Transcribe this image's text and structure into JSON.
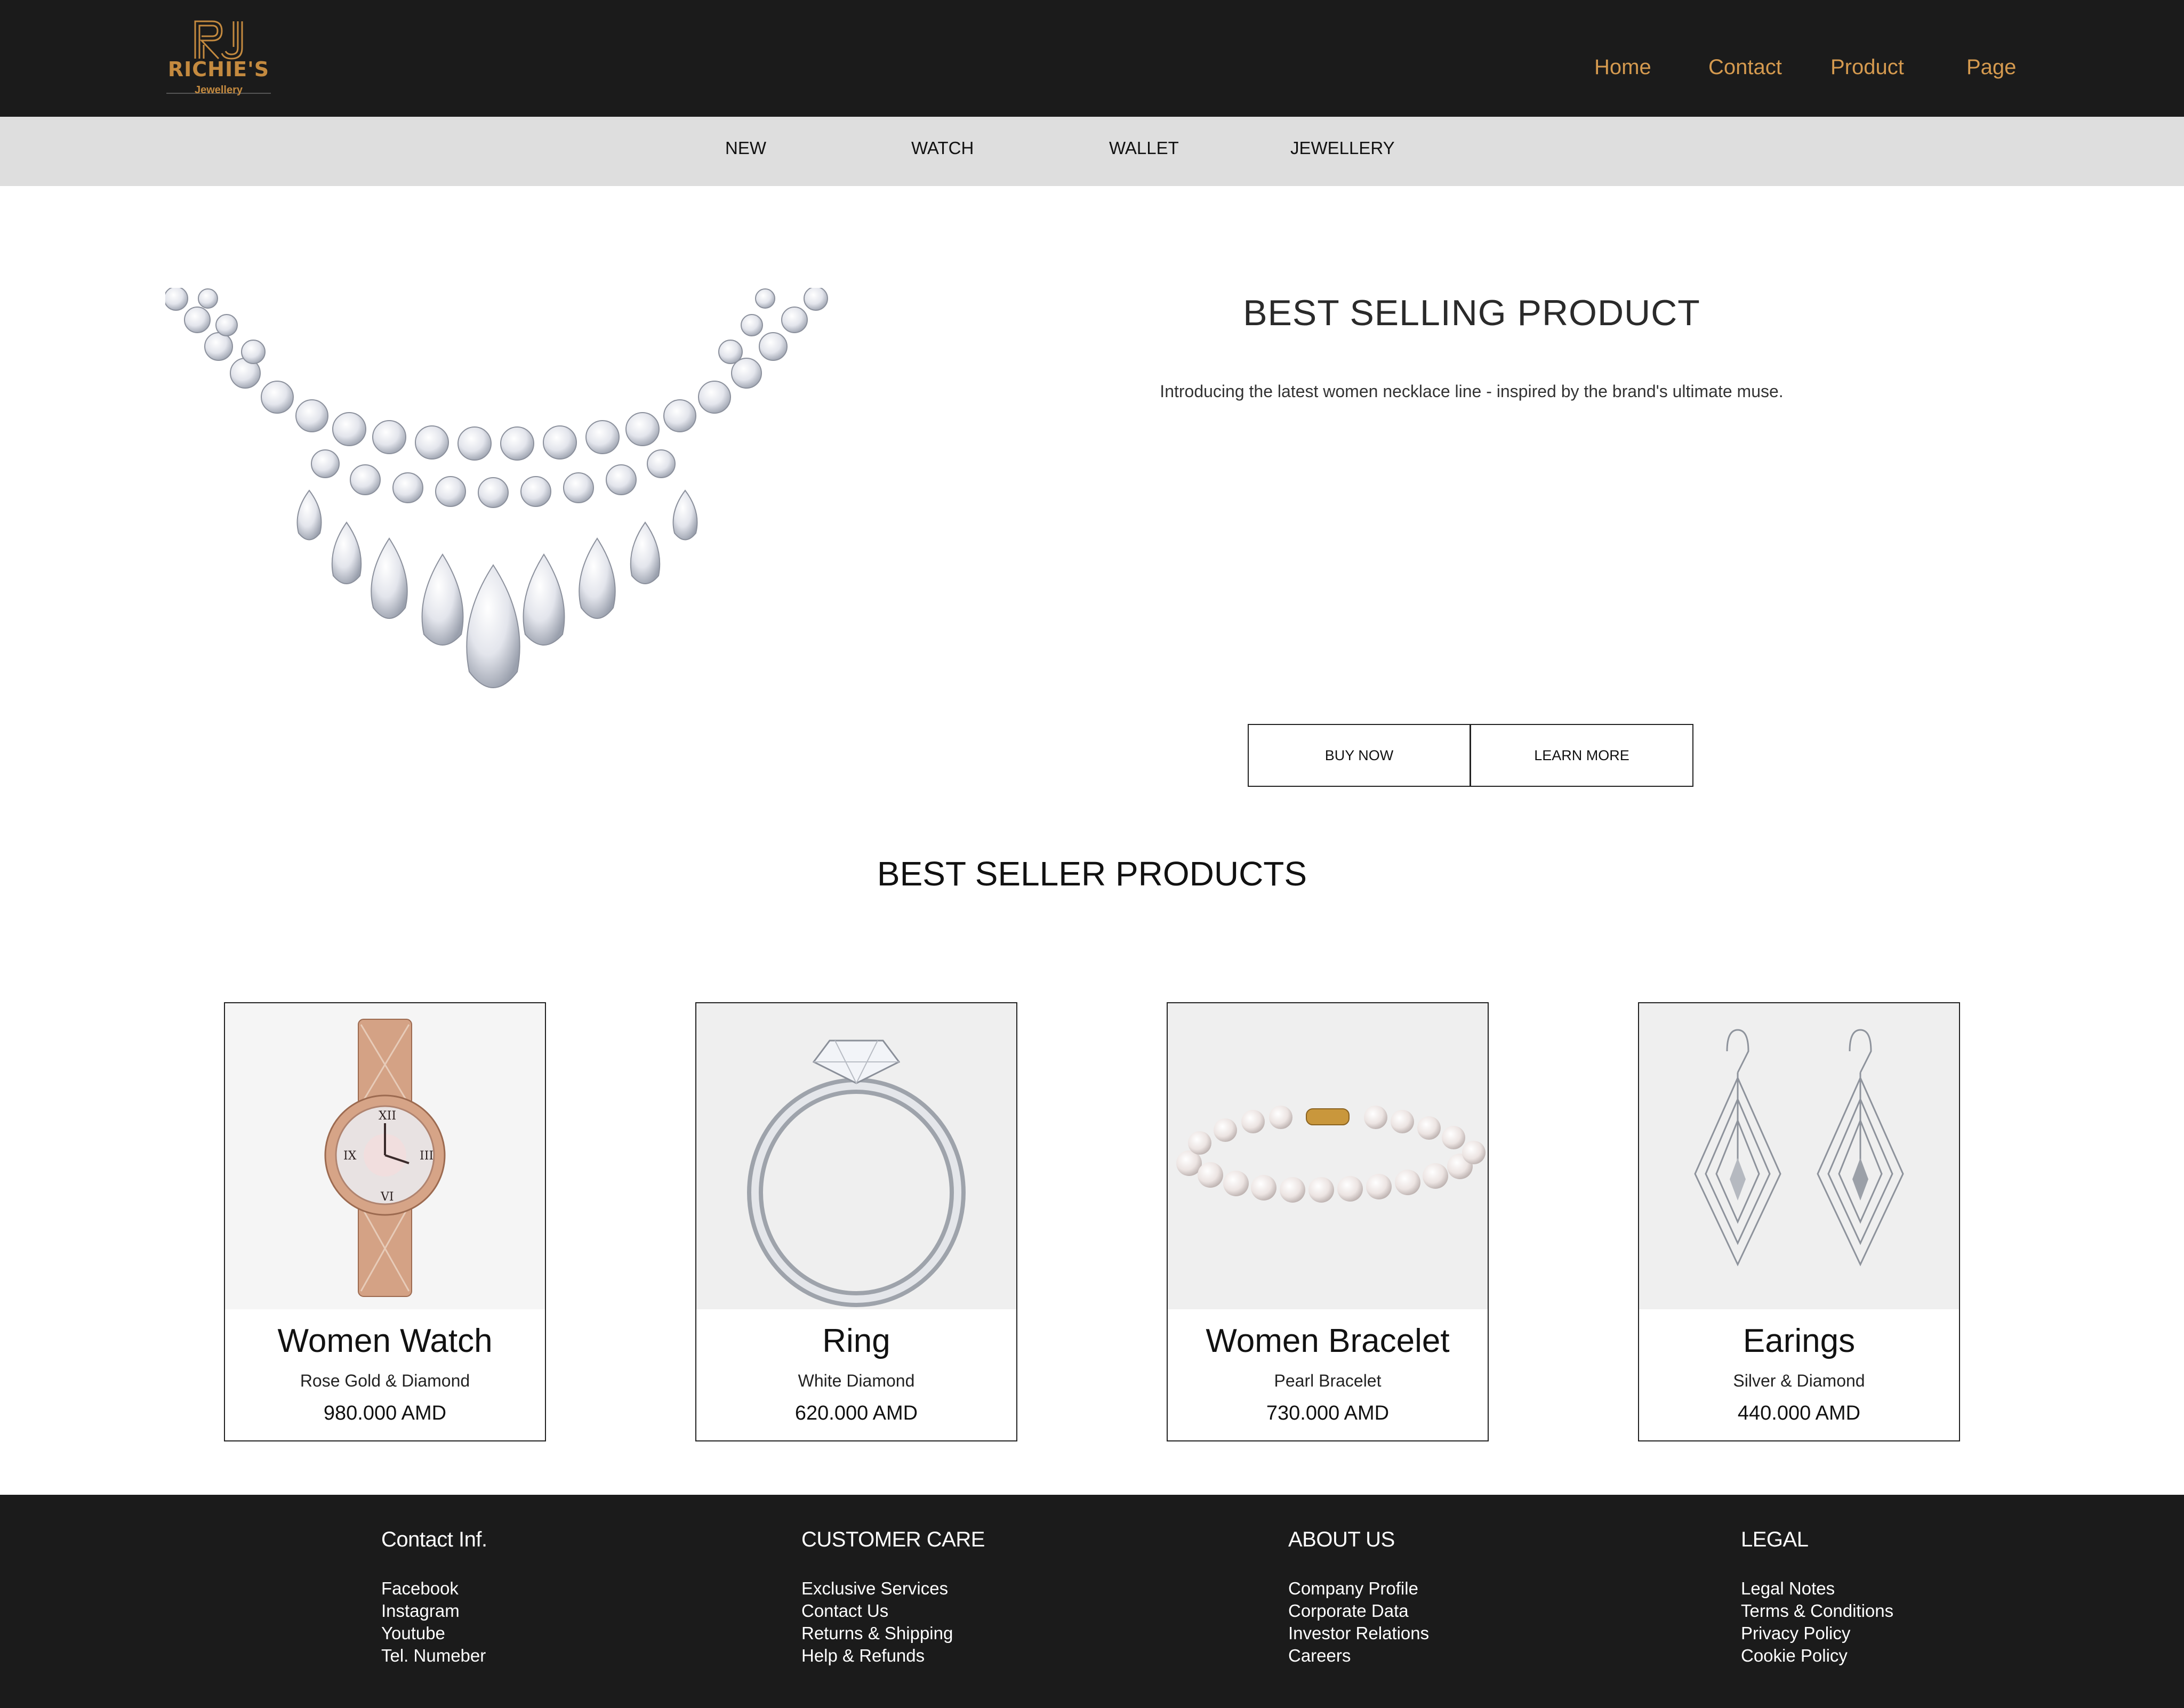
{
  "brand": {
    "name": "RICHIE'S",
    "monogram": "RJ",
    "tagline": "Jewellery",
    "accent": "#c48a3f"
  },
  "nav": {
    "items": [
      {
        "label": "Home"
      },
      {
        "label": "Contact"
      },
      {
        "label": "Product"
      },
      {
        "label": "Page"
      }
    ],
    "color": "#d59a4f"
  },
  "categories": [
    {
      "label": "NEW"
    },
    {
      "label": "WATCH"
    },
    {
      "label": "WALLET"
    },
    {
      "label": "JEWELLERY"
    }
  ],
  "hero": {
    "title": "BEST SELLING PRODUCT",
    "description": "Introducing the latest women necklace line - inspired by the brand's ultimate muse.",
    "buy_label": "BUY NOW",
    "learn_label": "LEARN MORE",
    "image_icon": "diamond-necklace-image"
  },
  "best_sellers": {
    "title": "BEST SELLER PRODUCTS",
    "products": [
      {
        "name": "Women Watch",
        "subtitle": "Rose Gold & Diamond",
        "price": "980.000 AMD",
        "image_icon": "rose-gold-watch-image"
      },
      {
        "name": "Ring",
        "subtitle": "White Diamond",
        "price": "620.000 AMD",
        "image_icon": "diamond-ring-image"
      },
      {
        "name": "Women Bracelet",
        "subtitle": "Pearl Bracelet",
        "price": "730.000 AMD",
        "image_icon": "pearl-bracelet-image"
      },
      {
        "name": "Earings",
        "subtitle": "Silver & Diamond",
        "price": "440.000 AMD",
        "image_icon": "diamond-earrings-image"
      }
    ]
  },
  "footer": {
    "columns": [
      {
        "heading": "Contact Inf.",
        "links": [
          "Facebook",
          "Instagram",
          "Youtube",
          "Tel. Numeber"
        ]
      },
      {
        "heading": "CUSTOMER CARE",
        "links": [
          "Exclusive Services",
          "Contact Us",
          "Returns & Shipping",
          "Help & Refunds"
        ]
      },
      {
        "heading": "ABOUT US",
        "links": [
          "Company Profile",
          "Corporate Data",
          "Investor Relations",
          "Careers"
        ]
      },
      {
        "heading": "LEGAL",
        "links": [
          "Legal Notes",
          "Terms & Conditions",
          "Privacy Policy",
          "Cookie Policy"
        ]
      }
    ]
  }
}
